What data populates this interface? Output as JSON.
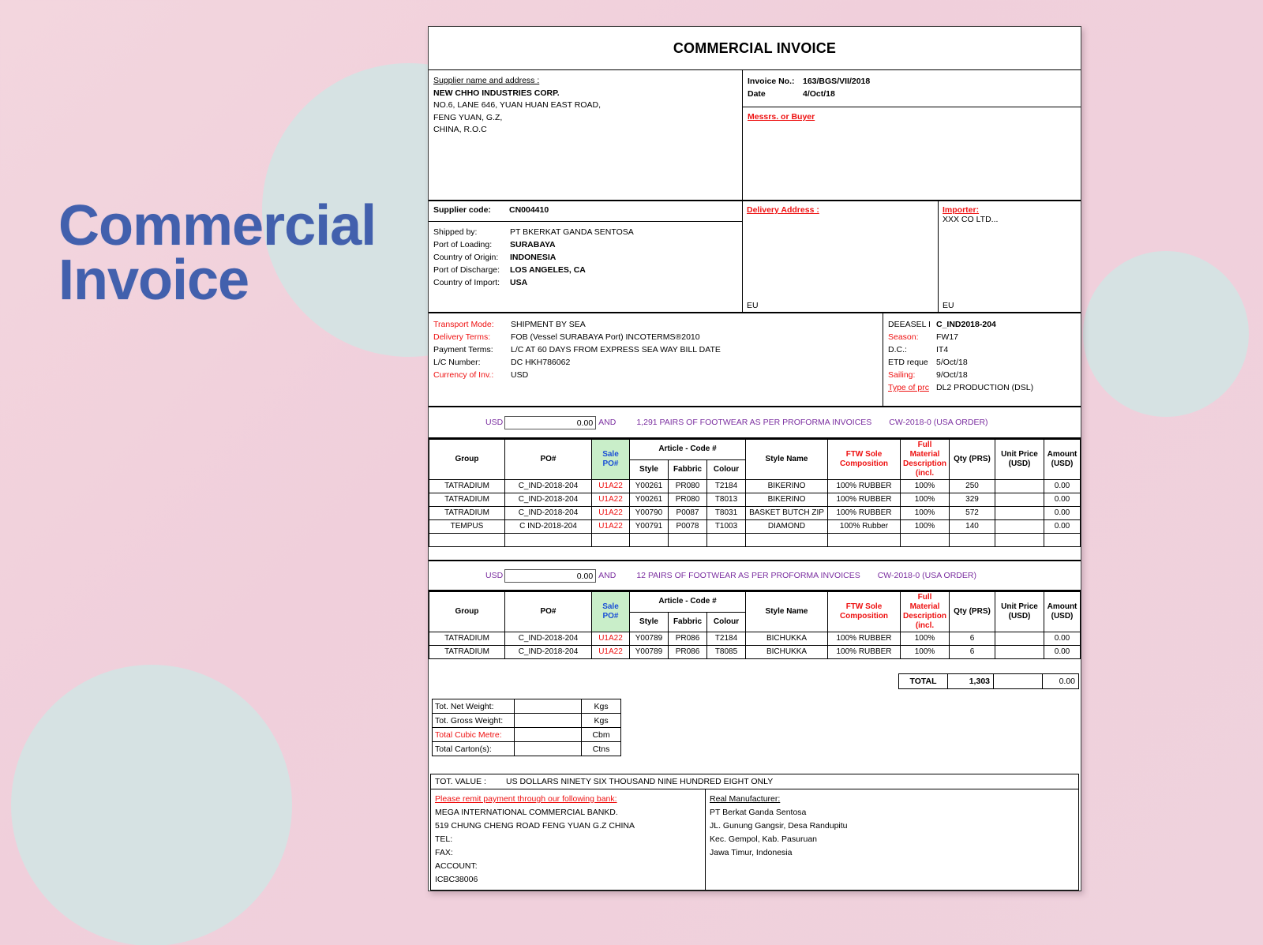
{
  "cover": {
    "title_line1": "Commercial",
    "title_line2": "Invoice",
    "accent_color": "#4260ad",
    "circle_color": "#d6e2e3",
    "background_color": "#f0cfdb"
  },
  "document": {
    "title": "COMMERCIAL INVOICE",
    "supplier": {
      "heading": "Supplier name and address :",
      "name": "NEW CHHO INDUSTRIES CORP.",
      "address_lines": [
        "NO.6, LANE 646, YUAN HUAN EAST ROAD,",
        "FENG YUAN, G.Z,",
        "CHINA, R.O.C"
      ]
    },
    "invoice_meta": {
      "invoice_no_label": "Invoice No.:",
      "invoice_no_value": "163/BGS/VII/2018",
      "date_label": "Date",
      "date_colon": ":",
      "date_value": "4/Oct/18",
      "buyer_heading": "Messrs. or Buyer"
    },
    "supplier_code": {
      "label": "Supplier code:",
      "value": "CN004410"
    },
    "shipping": [
      {
        "label": "Shipped by:",
        "value": "PT BKERKAT GANDA SENTOSA",
        "bold": false
      },
      {
        "label": "Port of Loading:",
        "value": "SURABAYA",
        "bold": true
      },
      {
        "label": "Country of Origin:",
        "value": "INDONESIA",
        "bold": true
      },
      {
        "label": "Port of Discharge:",
        "value": "LOS ANGELES, CA",
        "bold": true
      },
      {
        "label": "Country of Import:",
        "value": "USA",
        "bold": true
      }
    ],
    "delivery_address": {
      "heading": "Delivery Address :",
      "footer": "EU"
    },
    "importer": {
      "heading": "Importer:",
      "name": "XXX CO LTD...",
      "footer": "EU"
    },
    "terms": [
      {
        "label": "Transport Mode:",
        "value": "SHIPMENT BY SEA",
        "label_red": true
      },
      {
        "label": "Delivery Terms:",
        "value": "FOB (Vessel SURABAYA Port) INCOTERMS®2010",
        "label_red": true
      },
      {
        "label": "Payment Terms:",
        "value": "L/C AT 60 DAYS FROM EXPRESS SEA WAY BILL  DATE",
        "label_red": false
      },
      {
        "label": "L/C Number:",
        "value": "DC HKH786062",
        "label_red": false
      },
      {
        "label": "Currency of Inv.:",
        "value": "USD",
        "label_red": true
      }
    ],
    "order_info": [
      {
        "label": "DEEASEL I",
        "value": "C_IND2018-204",
        "label_red": false,
        "bold": true
      },
      {
        "label": "Season:",
        "value": "FW17",
        "label_red": true,
        "bold": false
      },
      {
        "label": "D.C.:",
        "value": "IT4",
        "label_red": false,
        "bold": false
      },
      {
        "label": "ETD reque",
        "value": "5/Oct/18",
        "label_red": false,
        "bold": false
      },
      {
        "label": "Sailing:",
        "value": "9/Oct/18",
        "label_red": true,
        "bold": false
      },
      {
        "label": "Type of prc",
        "value": "DL2  PRODUCTION (DSL)",
        "label_red": true,
        "bold": false
      }
    ],
    "columns": {
      "group": "Group",
      "po": "PO#",
      "sale_po_line1": "Sale",
      "sale_po_line2": "PO#",
      "article_code": "Article - Code #",
      "style": "Style",
      "fabric": "Fabbric",
      "colour": "Colour",
      "style_name": "Style Name",
      "sole_line1": "FTW Sole",
      "sole_line2": "Composition",
      "matdesc_line1": "Full Material",
      "matdesc_line2": "Description",
      "matdesc_line3": "(incl.",
      "qty": "Qty (PRS)",
      "unit_price_line1": "Unit Price",
      "unit_price_line2": "(USD)",
      "amount_line1": "Amount",
      "amount_line2": "(USD)"
    },
    "sections": [
      {
        "usd_label": "USD",
        "usd_amount": "0.00",
        "and": "AND",
        "phrase": "1,291  PAIRS OF FOOTWEAR AS PER PROFORMA INVOICES",
        "order_ref": "CW-2018-0 (USA ORDER)",
        "rows": [
          {
            "group": "TATRADIUM",
            "po": "C_IND-2018-204",
            "sale_po": "U1A22",
            "style": "Y00261",
            "fabric": "PR080",
            "colour": "T2184",
            "style_name": "BIKERINO",
            "sole": "100% RUBBER",
            "matdesc": "100%",
            "qty": "250",
            "unit_price": "",
            "amount": "0.00"
          },
          {
            "group": "TATRADIUM",
            "po": "C_IND-2018-204",
            "sale_po": "U1A22",
            "style": "Y00261",
            "fabric": "PR080",
            "colour": "T8013",
            "style_name": "BIKERINO",
            "sole": "100% RUBBER",
            "matdesc": "100%",
            "qty": "329",
            "unit_price": "",
            "amount": "0.00"
          },
          {
            "group": "TATRADIUM",
            "po": "C_IND-2018-204",
            "sale_po": "U1A22",
            "style": "Y00790",
            "fabric": "P0087",
            "colour": "T8031",
            "style_name": "BASKET BUTCH ZIP",
            "sole": "100% RUBBER",
            "matdesc": "100%",
            "qty": "572",
            "unit_price": "",
            "amount": "0.00"
          },
          {
            "group": "TEMPUS",
            "po": "C IND-2018-204",
            "sale_po": "U1A22",
            "style": "Y00791",
            "fabric": "P0078",
            "colour": "T1003",
            "style_name": "DIAMOND",
            "sole": "100% Rubber",
            "matdesc": "100%",
            "qty": "140",
            "unit_price": "",
            "amount": "0.00"
          },
          {
            "group": "",
            "po": "",
            "sale_po": "",
            "style": "",
            "fabric": "",
            "colour": "",
            "style_name": "",
            "sole": "",
            "matdesc": "",
            "qty": "",
            "unit_price": "",
            "amount": ""
          }
        ]
      },
      {
        "usd_label": "USD",
        "usd_amount": "0.00",
        "and": "AND",
        "phrase": "12  PAIRS OF FOOTWEAR AS PER PROFORMA INVOICES",
        "order_ref": "CW-2018-0 (USA ORDER)",
        "rows": [
          {
            "group": "TATRADIUM",
            "po": "C_IND-2018-204",
            "sale_po": "U1A22",
            "style": "Y00789",
            "fabric": "PR086",
            "colour": "T2184",
            "style_name": "BICHUKKA",
            "sole": "100% RUBBER",
            "matdesc": "100%",
            "qty": "6",
            "unit_price": "",
            "amount": "0.00"
          },
          {
            "group": "TATRADIUM",
            "po": "C_IND-2018-204",
            "sale_po": "U1A22",
            "style": "Y00789",
            "fabric": "PR086",
            "colour": "T8085",
            "style_name": "BICHUKKA",
            "sole": "100% RUBBER",
            "matdesc": "100%",
            "qty": "6",
            "unit_price": "",
            "amount": "0.00"
          }
        ]
      }
    ],
    "totals": {
      "label": "TOTAL",
      "qty": "1,303",
      "unit_price": "",
      "amount": "0.00"
    },
    "weights": [
      {
        "label": "Tot. Net Weight:",
        "value": "",
        "unit": "Kgs",
        "label_red": false
      },
      {
        "label": "Tot. Gross Weight:",
        "value": "",
        "unit": "Kgs",
        "label_red": false
      },
      {
        "label": "Total Cubic Metre:",
        "value": "",
        "unit": "Cbm",
        "label_red": true
      },
      {
        "label": "Total Carton(s):",
        "value": "",
        "unit": "Ctns",
        "label_red": false
      }
    ],
    "total_value": {
      "label": "TOT. VALUE :",
      "value": "US DOLLARS NINETY SIX THOUSAND NINE HUNDRED EIGHT ONLY"
    },
    "bank": {
      "heading": "Please remit payment  through our following bank:",
      "lines": [
        "MEGA INTERNATIONAL  COMMERCIAL  BANKD.",
        "519 CHUNG CHENG ROAD FENG YUAN G.Z CHINA",
        "TEL:",
        "FAX:",
        "ACCOUNT:",
        " ICBC38006"
      ]
    },
    "manufacturer": {
      "heading": "Real Manufacturer:",
      "lines": [
        "PT Berkat Ganda Sentosa",
        "JL. Gunung Gangsir, Desa Randupitu",
        "Kec. Gempol, Kab. Pasuruan",
        "Jawa Timur, Indonesia"
      ]
    }
  }
}
